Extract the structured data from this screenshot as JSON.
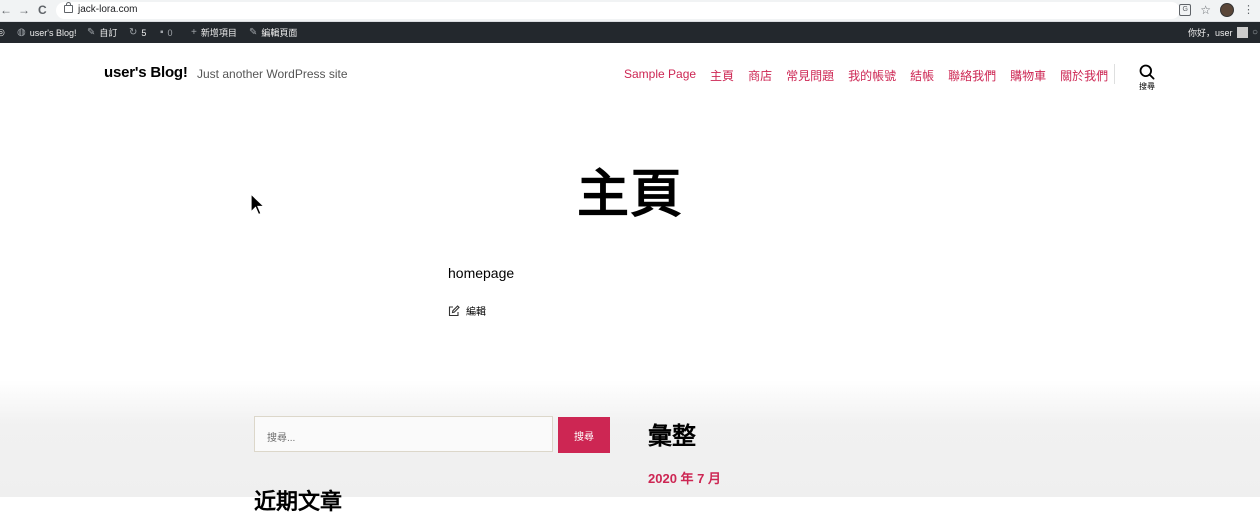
{
  "browser": {
    "back": "←",
    "forward": "→",
    "reload": "C",
    "url": "jack-lora.com",
    "translate_glyph": "G",
    "star_glyph": "☆",
    "more_glyph": "⋮"
  },
  "adminbar": {
    "wp_logo_glyph": "◎",
    "site_name": "user's Blog!",
    "customize": "自訂",
    "updates_count": "5",
    "comments_count": "0",
    "new_item": "新增項目",
    "edit_page": "編輯頁面",
    "greeting": "你好，user"
  },
  "header": {
    "site_title": "user's Blog!",
    "tagline": "Just another WordPress site",
    "nav": [
      "Sample Page",
      "主頁",
      "商店",
      "常見問題",
      "我的帳號",
      "結帳",
      "聯絡我們",
      "購物車",
      "關於我們"
    ],
    "search_label": "搜尋"
  },
  "content": {
    "title": "主頁",
    "body": "homepage",
    "edit_link": "編輯"
  },
  "footer": {
    "search_placeholder": "搜尋...",
    "search_button": "搜尋",
    "recent_posts_heading": "近期文章",
    "archive_heading": "彙整",
    "archive_link": "2020 年 7 月"
  },
  "colors": {
    "accent": "#cd2653",
    "adminbar_bg": "#23282d"
  }
}
